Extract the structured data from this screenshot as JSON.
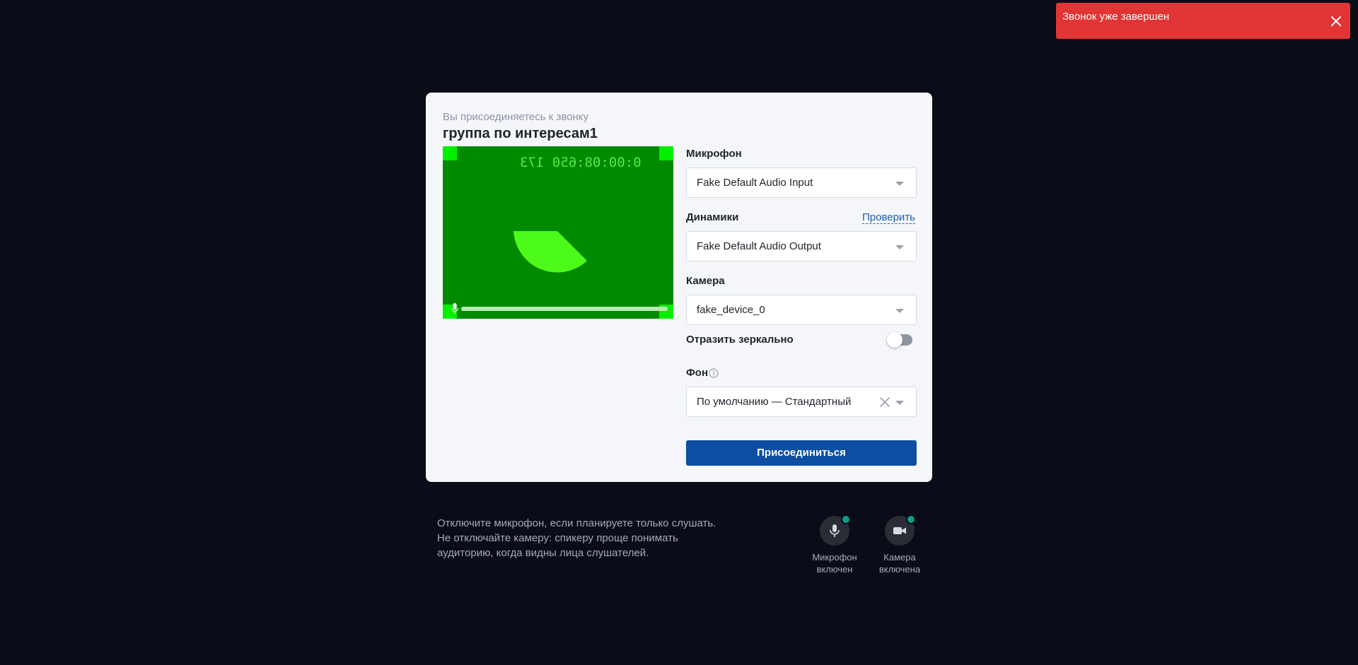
{
  "toast": {
    "message": "Звонок уже завершен",
    "color": "#e13434"
  },
  "card": {
    "subtitle": "Вы присоединяетесь к звонку",
    "title": "группа по интересам1",
    "preview": {
      "timestamp": "0:00:08:650 173",
      "background_color": "#008a00",
      "mic_level": 1.0
    },
    "microphone": {
      "label": "Микрофон",
      "value": "Fake Default Audio Input"
    },
    "speakers": {
      "label": "Динамики",
      "value": "Fake Default Audio Output",
      "test_link": "Проверить"
    },
    "camera": {
      "label": "Камера",
      "value": "fake_device_0"
    },
    "mirror": {
      "label": "Отразить зеркально",
      "enabled": false
    },
    "background": {
      "label": "Фон",
      "value": "По умолчанию — Стандартный"
    },
    "join_button": {
      "label": "Присоединиться",
      "color": "#0b4ea2"
    }
  },
  "hint": {
    "lines": [
      "Отключите микрофон, если планируете только слушать.",
      "Не отключайте камеру: спикеру проще понимать",
      "аудиторию, когда видны лица слушателей."
    ]
  },
  "controls": {
    "microphone": {
      "line1": "Микрофон",
      "line2": "включен",
      "icon": "microphone-icon",
      "status_color": "#0f9c8a"
    },
    "camera": {
      "line1": "Камера",
      "line2": "включена",
      "icon": "video-camera-icon",
      "status_color": "#0f9c8a"
    }
  }
}
